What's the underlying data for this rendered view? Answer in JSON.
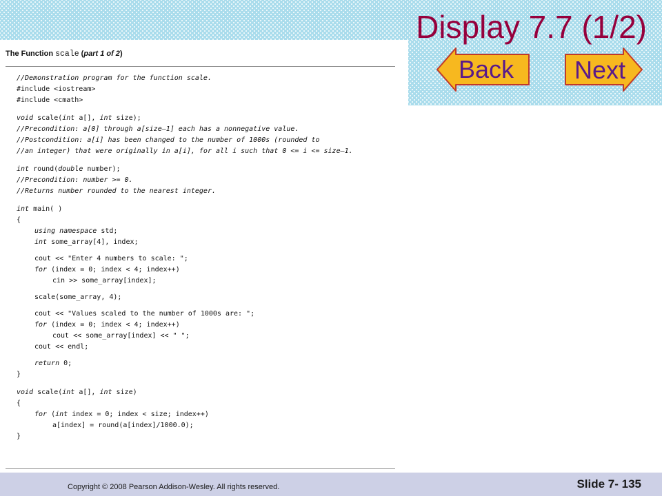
{
  "slide": {
    "title": "Display 7.7 (1/2)",
    "slide_number": "Slide 7- 135",
    "copyright": "Copyright © 2008 Pearson Addison-Wesley.  All rights reserved."
  },
  "nav": {
    "back_label": "Back",
    "next_label": "Next",
    "button_fill": "#f7b81f",
    "button_stroke": "#c0392b"
  },
  "colors": {
    "title": "#96003c",
    "background_pattern": "#a9dcec",
    "footer": "#cdd0e6"
  },
  "display": {
    "caption_prefix": "The Function",
    "caption_function": "scale",
    "caption_part": "part 1 of 2",
    "code": [
      {
        "segments": [
          {
            "t": "//Demonstration program for the function scale.",
            "i": true
          }
        ]
      },
      {
        "segments": [
          {
            "t": "#include <iostream>"
          }
        ]
      },
      {
        "segments": [
          {
            "t": "#include <cmath>"
          }
        ]
      },
      {
        "gap": true
      },
      {
        "segments": [
          {
            "t": "void",
            "i": true
          },
          {
            "t": " scale("
          },
          {
            "t": "int",
            "i": true
          },
          {
            "t": " a[], "
          },
          {
            "t": "int",
            "i": true
          },
          {
            "t": " size);"
          }
        ]
      },
      {
        "segments": [
          {
            "t": "//Precondition: a[0] through a[size–1] each has a nonnegative value.",
            "i": true
          }
        ]
      },
      {
        "segments": [
          {
            "t": "//Postcondition: a[i] has been changed to the number of 1000s (rounded to",
            "i": true
          }
        ]
      },
      {
        "segments": [
          {
            "t": "//an integer) that were originally in a[i], for all i such that 0 <= i <= size–1.",
            "i": true
          }
        ]
      },
      {
        "gap": true
      },
      {
        "segments": [
          {
            "t": "int",
            "i": true
          },
          {
            "t": " round("
          },
          {
            "t": "double",
            "i": true
          },
          {
            "t": " number);"
          }
        ]
      },
      {
        "segments": [
          {
            "t": "//Precondition: number >= 0.",
            "i": true
          }
        ]
      },
      {
        "segments": [
          {
            "t": "//Returns number rounded to the nearest integer.",
            "i": true
          }
        ]
      },
      {
        "gap": true
      },
      {
        "segments": [
          {
            "t": "int",
            "i": true
          },
          {
            "t": " main( )"
          }
        ]
      },
      {
        "segments": [
          {
            "t": "{"
          }
        ]
      },
      {
        "indent": 1,
        "segments": [
          {
            "t": "using namespace",
            "i": true
          },
          {
            "t": " std;"
          }
        ]
      },
      {
        "indent": 1,
        "segments": [
          {
            "t": "int",
            "i": true
          },
          {
            "t": " some_array[4], index;"
          }
        ]
      },
      {
        "gap": "sm"
      },
      {
        "indent": 1,
        "segments": [
          {
            "t": "cout << \"Enter 4 numbers to scale: \";"
          }
        ]
      },
      {
        "indent": 1,
        "segments": [
          {
            "t": "for",
            "i": true
          },
          {
            "t": " (index = 0; index < 4; index++)"
          }
        ]
      },
      {
        "indent": 2,
        "segments": [
          {
            "t": "cin >> some_array[index];"
          }
        ]
      },
      {
        "gap": "sm"
      },
      {
        "indent": 1,
        "segments": [
          {
            "t": "scale(some_array, 4);"
          }
        ]
      },
      {
        "gap": "sm"
      },
      {
        "indent": 1,
        "segments": [
          {
            "t": "cout << \"Values scaled to the number of 1000s are: \";"
          }
        ]
      },
      {
        "indent": 1,
        "segments": [
          {
            "t": "for",
            "i": true
          },
          {
            "t": " (index = 0; index < 4; index++)"
          }
        ]
      },
      {
        "indent": 2,
        "segments": [
          {
            "t": "cout << some_array[index] << \" \";"
          }
        ]
      },
      {
        "indent": 1,
        "segments": [
          {
            "t": "cout << endl;"
          }
        ]
      },
      {
        "gap": "sm"
      },
      {
        "indent": 1,
        "segments": [
          {
            "t": "return",
            "i": true
          },
          {
            "t": " 0;"
          }
        ]
      },
      {
        "segments": [
          {
            "t": "}"
          }
        ]
      },
      {
        "gap": true
      },
      {
        "segments": [
          {
            "t": "void",
            "i": true
          },
          {
            "t": " scale("
          },
          {
            "t": "int",
            "i": true
          },
          {
            "t": " a[], "
          },
          {
            "t": "int",
            "i": true
          },
          {
            "t": " size)"
          }
        ]
      },
      {
        "segments": [
          {
            "t": "{"
          }
        ]
      },
      {
        "indent": 1,
        "segments": [
          {
            "t": "for",
            "i": true
          },
          {
            "t": " ("
          },
          {
            "t": "int",
            "i": true
          },
          {
            "t": " index = 0; index < size; index++)"
          }
        ]
      },
      {
        "indent": 2,
        "segments": [
          {
            "t": "a[index] = round(a[index]/1000.0);"
          }
        ]
      },
      {
        "segments": [
          {
            "t": "}"
          }
        ]
      }
    ]
  }
}
